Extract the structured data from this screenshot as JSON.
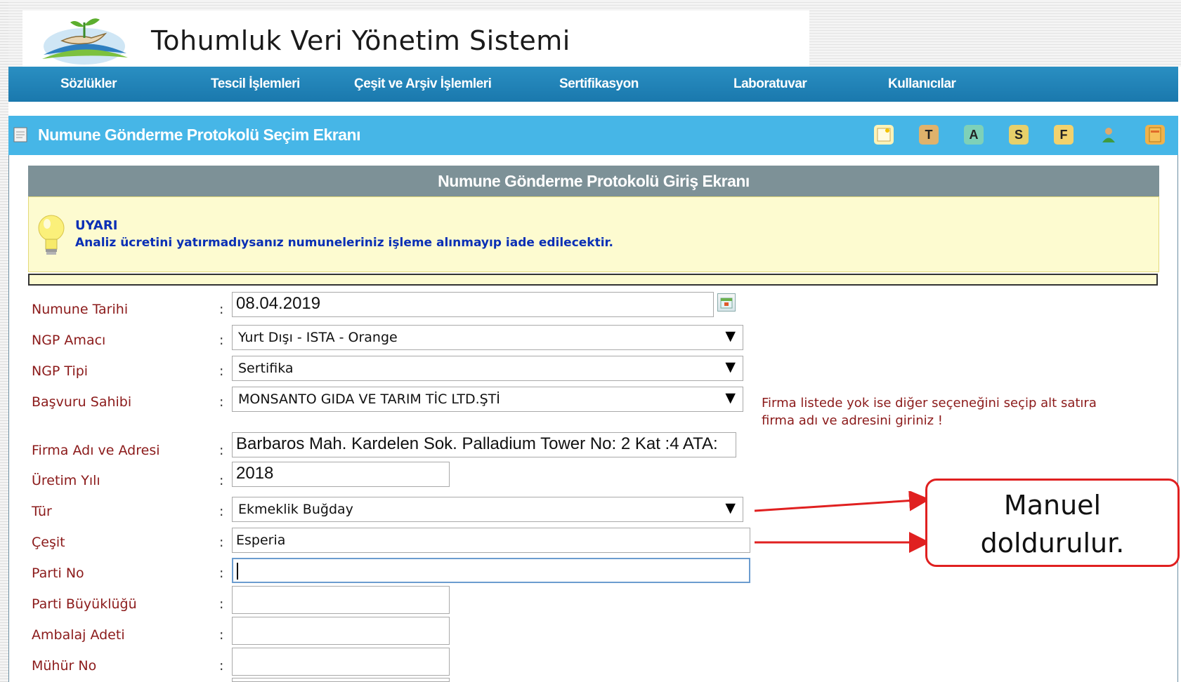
{
  "app": {
    "title": "Tohumluk Veri Yönetim Sistemi"
  },
  "nav": {
    "items": [
      {
        "label": "Sözlükler"
      },
      {
        "label": "Tescil İşlemleri"
      },
      {
        "label": "Çeşit ve Arşiv İşlemleri"
      },
      {
        "label": "Sertifikasyon"
      },
      {
        "label": "Laboratuvar"
      },
      {
        "label": "Kullanıcılar"
      }
    ]
  },
  "subbar": {
    "title": "Numune Gönderme Protokolü Seçim Ekranı",
    "tools": [
      {
        "icon": "new-document-icon",
        "glyph": ""
      },
      {
        "icon": "letter-t-icon",
        "glyph": "T"
      },
      {
        "icon": "letter-a-icon",
        "glyph": "A"
      },
      {
        "icon": "letter-s-icon",
        "glyph": "S"
      },
      {
        "icon": "letter-f-icon",
        "glyph": "F"
      },
      {
        "icon": "user-icon",
        "glyph": ""
      },
      {
        "icon": "exit-icon",
        "glyph": ""
      }
    ]
  },
  "form": {
    "heading": "Numune Gönderme Protokolü Giriş Ekranı",
    "warning": {
      "title": "UYARI",
      "text": "Analiz ücretini yatırmadıysanız numuneleriniz işleme alınmayıp iade edilecektir."
    },
    "fields": {
      "numune_tarihi": {
        "label": "Numune Tarihi",
        "value": "08.04.2019"
      },
      "ngp_amaci": {
        "label": "NGP Amacı",
        "value": "Yurt Dışı - ISTA - Orange"
      },
      "ngp_tipi": {
        "label": "NGP Tipi",
        "value": "Sertifika"
      },
      "basvuru_sahibi": {
        "label": "Başvuru Sahibi",
        "value": "MONSANTO GIDA VE TARIM TİC LTD.ŞTİ"
      },
      "firma_adi": {
        "label": "Firma Adı ve Adresi",
        "value": "Barbaros Mah. Kardelen Sok. Palladium Tower No: 2 Kat :4 ATA:"
      },
      "uretim_yili": {
        "label": "Üretim Yılı",
        "value": "2018"
      },
      "tur": {
        "label": "Tür",
        "value": "Ekmeklik Buğday"
      },
      "cesit": {
        "label": "Çeşit",
        "value": "Esperia"
      },
      "parti_no": {
        "label": "Parti No",
        "value": ""
      },
      "parti_buyuklugu": {
        "label": "Parti Büyüklüğü",
        "value": ""
      },
      "ambalaj_adeti": {
        "label": "Ambalaj Adeti",
        "value": ""
      },
      "muhur_no": {
        "label": "Mühür No",
        "value": ""
      }
    },
    "colon": ":",
    "hint_line1": "Firma listede yok ise diğer seçeneğini seçip alt satıra",
    "hint_line2": "firma adı ve adresini giriniz !"
  },
  "callout": {
    "line1": "Manuel",
    "line2": "doldurulur."
  },
  "colors": {
    "navbar": "#1a78ad",
    "subbar": "#46b6e7",
    "panel_header": "#7d9197",
    "warning_bg": "#fdfbd0",
    "label_text": "#8b1a1a",
    "warning_text": "#0a2fb5",
    "callout_border": "#e02020"
  }
}
